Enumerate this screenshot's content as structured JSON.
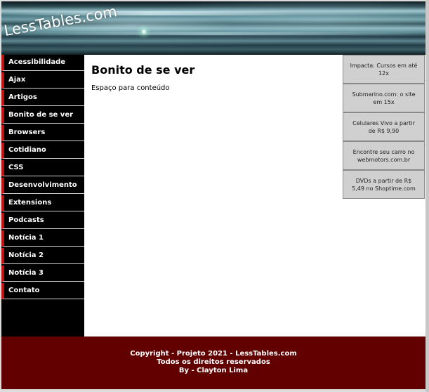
{
  "header": {
    "logo_text": "LessTables.com"
  },
  "sidebar": {
    "items": [
      {
        "label": "Acessibilidade"
      },
      {
        "label": "Ajax"
      },
      {
        "label": "Artigos"
      },
      {
        "label": "Bonito de se ver"
      },
      {
        "label": "Browsers"
      },
      {
        "label": "Cotidiano"
      },
      {
        "label": "CSS"
      },
      {
        "label": "Desenvolvimento"
      },
      {
        "label": "Extensions"
      },
      {
        "label": "Podcasts"
      },
      {
        "label": "Notícia 1"
      },
      {
        "label": "Notícia 2"
      },
      {
        "label": "Notícia 3"
      },
      {
        "label": "Contato"
      }
    ]
  },
  "main": {
    "title": "Bonito de se ver",
    "content": "Espaço para conteúdo"
  },
  "ads": {
    "items": [
      {
        "text": "Impacta: Cursos em até 12x"
      },
      {
        "text": "Submarino.com: o site em 15x"
      },
      {
        "text": "Celulares Vivo a partir de R$ 9,90"
      },
      {
        "text": "Encontre seu carro no webmotors.com.br"
      },
      {
        "text": "DVDs a partir de R$ 5,49 no Shoptime.com"
      }
    ]
  },
  "footer": {
    "line1": "Copyright - Projeto 2021 - LessTables.com",
    "line2": "Todos os direitos reservados",
    "line3": "By - Clayton Lima"
  },
  "colors": {
    "sidebar_bg": "#000000",
    "sidebar_accent": "#c41010",
    "footer_bg": "#620000",
    "ad_bg": "#d0d0d0"
  }
}
